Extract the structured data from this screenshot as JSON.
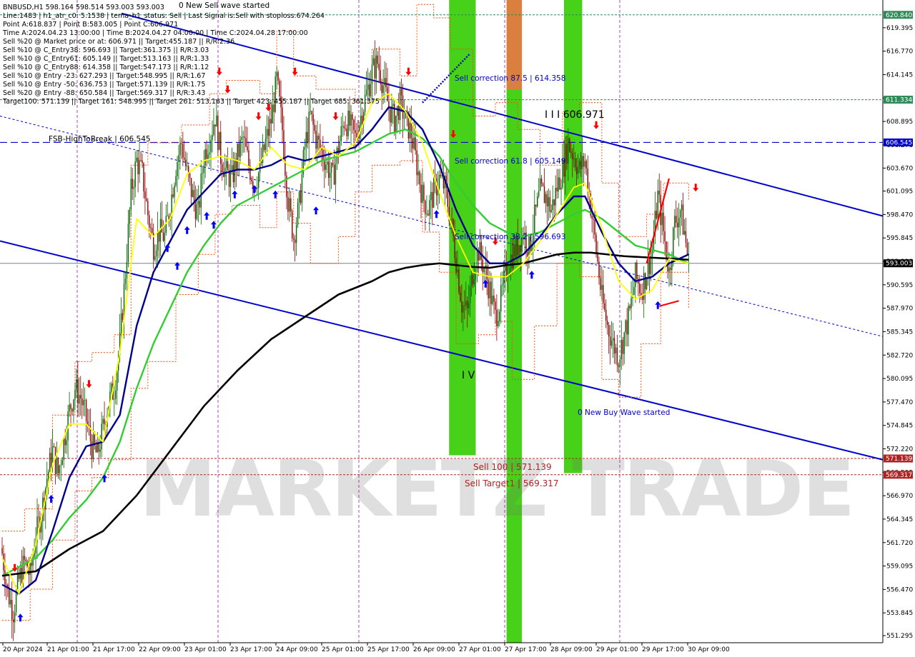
{
  "header": {
    "lines": [
      "BNBUSD,H1  598.164 598.514 593.003 593.003",
      "Line:1483 | h1_atr_c0: 5.1538 | tema_h1_status: Sell | Last Signal is:Sell with stoploss:674.264",
      "Point A:618.837 | Point B:583.005 | Point C:606.971",
      "Time A:2024.04.23 13:00:00 | Time B:2024.04.27 04:00:00 | Time C:2024.04.28 17:00:00",
      "Sell %20 @ Market price or at: 606.971 || Target:455.187 || R/R:2.36",
      "Sell %10 @ C_Entry38: 596.693 || Target:361.375 || R/R:3.03",
      "Sell %10 @ C_Entry61: 605.149 || Target:513.163 || R/R:1.33",
      "Sell %10 @ C_Entry88: 614.358 || Target:547.173 || R/R:1.12",
      "Sell %10 @ Entry -23: 627.293 || Target:548.995 || R/R:1.67",
      "Sell %10 @ Entry -50: 636.753 || Target:571.139 || R/R:1.75",
      "Sell %20 @ Entry -88: 650.584 || Target:569.317 || R/R:3.43",
      "Target100: 571.139 || Target 161: 548.995 || Target 261: 513.163 || Target 423: 455.187 || Target 685: 361.375"
    ]
  },
  "annotations": {
    "new_sell_wave": "0 New Sell wave started",
    "new_buy_wave": "0 New Buy Wave started",
    "fsb_high": "FSB-HighToBreak | 606.545",
    "sell_corr_875": "Sell correction 87.5 | 614.358",
    "sell_corr_618": "Sell correction 61.8 | 605.149",
    "sell_corr_382": "Sell correction 38.2 | 596.693",
    "wave_label": "I I I 606.971",
    "wave_iv": "I V",
    "sell_100": "Sell 100 | 571.139",
    "sell_target1": "Sell Target1 | 569.317",
    "watermark": "MARKETZ TRADE"
  },
  "price_tags": {
    "p620": "620.840",
    "p611": "611.334",
    "p606": "606.545",
    "p593": "593.003",
    "p571": "571.139",
    "p569": "569.317"
  },
  "colors": {
    "up_candle": "#006400",
    "down_candle": "#8b0000",
    "ema_fast": "#ffff00",
    "ema_mid": "#00008b",
    "ema_slow": "#32cd32",
    "ema_long": "#000000",
    "channel": "#0000cd",
    "green_zone": "#33cc00",
    "orange_zone": "#d2691e",
    "red_line": "#ff0000"
  },
  "chart_data": {
    "type": "candlestick",
    "symbol": "BNBUSD",
    "timeframe": "H1",
    "ylim": [
      550.5,
      622.5
    ],
    "y_ticks": [
      "619.395",
      "616.770",
      "614.145",
      "611.520",
      "608.895",
      "606.270",
      "603.670",
      "601.095",
      "598.470",
      "595.845",
      "593.220",
      "590.595",
      "587.970",
      "585.345",
      "582.720",
      "580.095",
      "577.470",
      "574.845",
      "572.220",
      "569.595",
      "566.970",
      "564.345",
      "561.720",
      "559.095",
      "556.470",
      "553.845",
      "551.295"
    ],
    "x_ticks": [
      "20 Apr 2024",
      "21 Apr 01:00",
      "21 Apr 17:00",
      "22 Apr 09:00",
      "23 Apr 01:00",
      "23 Apr 17:00",
      "24 Apr 09:00",
      "25 Apr 01:00",
      "25 Apr 17:00",
      "26 Apr 09:00",
      "27 Apr 01:00",
      "27 Apr 17:00",
      "28 Apr 09:00",
      "29 Apr 01:00",
      "29 Apr 17:00",
      "30 Apr 09:00"
    ],
    "levels": {
      "fsb_high": 606.545,
      "last": 593.003,
      "sell_100": 571.139,
      "sell_target1": 569.317,
      "top_green": 620.84,
      "mid_green": 611.334
    },
    "anchors_close": [
      [
        0,
        560.5
      ],
      [
        4,
        556.2
      ],
      [
        8,
        554.0
      ],
      [
        12,
        557.5
      ],
      [
        16,
        559.5
      ],
      [
        20,
        558.0
      ],
      [
        24,
        562.5
      ],
      [
        28,
        565.0
      ],
      [
        32,
        569.0
      ],
      [
        36,
        572.0
      ],
      [
        40,
        569.5
      ],
      [
        44,
        573.0
      ],
      [
        48,
        576.5
      ],
      [
        52,
        579.0
      ],
      [
        56,
        578.0
      ],
      [
        60,
        575.5
      ],
      [
        64,
        572.5
      ],
      [
        68,
        571.5
      ],
      [
        72,
        574.5
      ],
      [
        76,
        577.5
      ],
      [
        80,
        579.0
      ],
      [
        84,
        584.0
      ],
      [
        88,
        592.0
      ],
      [
        92,
        601.0
      ],
      [
        96,
        604.5
      ],
      [
        100,
        603.0
      ],
      [
        104,
        598.5
      ],
      [
        108,
        595.0
      ],
      [
        112,
        596.5
      ],
      [
        116,
        596.0
      ],
      [
        120,
        599.5
      ],
      [
        124,
        604.0
      ],
      [
        128,
        606.5
      ],
      [
        132,
        603.0
      ],
      [
        136,
        600.5
      ],
      [
        140,
        598.5
      ],
      [
        144,
        605.0
      ],
      [
        148,
        607.0
      ],
      [
        152,
        609.5
      ],
      [
        156,
        605.0
      ],
      [
        160,
        603.0
      ],
      [
        164,
        602.5
      ],
      [
        168,
        605.0
      ],
      [
        172,
        607.0
      ],
      [
        176,
        604.0
      ],
      [
        180,
        602.0
      ],
      [
        184,
        603.5
      ],
      [
        188,
        606.5
      ],
      [
        192,
        609.0
      ],
      [
        196,
        613.5
      ],
      [
        200,
        608.0
      ],
      [
        204,
        600.0
      ],
      [
        208,
        596.0
      ],
      [
        212,
        599.5
      ],
      [
        216,
        606.0
      ],
      [
        220,
        609.5
      ],
      [
        224,
        607.0
      ],
      [
        228,
        605.5
      ],
      [
        232,
        604.0
      ],
      [
        236,
        602.5
      ],
      [
        240,
        606.0
      ],
      [
        244,
        609.0
      ],
      [
        248,
        608.5
      ],
      [
        252,
        607.0
      ],
      [
        256,
        609.5
      ],
      [
        260,
        612.0
      ],
      [
        264,
        614.5
      ],
      [
        268,
        615.5
      ],
      [
        272,
        613.0
      ],
      [
        276,
        610.5
      ],
      [
        280,
        609.0
      ],
      [
        284,
        611.0
      ],
      [
        288,
        609.0
      ],
      [
        292,
        607.5
      ],
      [
        296,
        604.0
      ],
      [
        300,
        600.5
      ],
      [
        304,
        599.0
      ],
      [
        308,
        601.0
      ],
      [
        312,
        602.5
      ],
      [
        316,
        601.5
      ],
      [
        320,
        598.0
      ],
      [
        324,
        593.5
      ],
      [
        328,
        588.5
      ],
      [
        332,
        587.5
      ],
      [
        336,
        592.0
      ],
      [
        340,
        594.5
      ],
      [
        344,
        592.5
      ],
      [
        348,
        590.0
      ],
      [
        352,
        587.0
      ],
      [
        356,
        589.0
      ],
      [
        360,
        592.5
      ],
      [
        364,
        594.0
      ],
      [
        368,
        595.0
      ],
      [
        372,
        596.5
      ],
      [
        376,
        594.5
      ],
      [
        380,
        598.0
      ],
      [
        384,
        601.0
      ],
      [
        388,
        600.5
      ],
      [
        392,
        599.0
      ],
      [
        396,
        601.5
      ],
      [
        400,
        603.5
      ],
      [
        404,
        606.5
      ],
      [
        408,
        605.0
      ],
      [
        412,
        603.5
      ],
      [
        416,
        604.5
      ],
      [
        420,
        599.5
      ],
      [
        424,
        594.5
      ],
      [
        428,
        589.0
      ],
      [
        432,
        586.0
      ],
      [
        436,
        584.0
      ],
      [
        440,
        582.5
      ],
      [
        444,
        585.0
      ],
      [
        448,
        587.5
      ],
      [
        452,
        591.5
      ],
      [
        456,
        590.0
      ],
      [
        460,
        592.0
      ],
      [
        464,
        594.5
      ],
      [
        468,
        600.5
      ],
      [
        472,
        596.5
      ],
      [
        476,
        592.0
      ],
      [
        480,
        597.5
      ],
      [
        484,
        599.0
      ],
      [
        487,
        596.5
      ],
      [
        490,
        593.0
      ]
    ],
    "ema_fast": [
      [
        0,
        560
      ],
      [
        12,
        556
      ],
      [
        24,
        561.5
      ],
      [
        36,
        570.5
      ],
      [
        48,
        575
      ],
      [
        60,
        575
      ],
      [
        72,
        573
      ],
      [
        84,
        583
      ],
      [
        96,
        598
      ],
      [
        108,
        596
      ],
      [
        120,
        598
      ],
      [
        132,
        603
      ],
      [
        144,
        604.5
      ],
      [
        156,
        605
      ],
      [
        168,
        604.5
      ],
      [
        180,
        603.5
      ],
      [
        192,
        606
      ],
      [
        204,
        604
      ],
      [
        216,
        603.5
      ],
      [
        228,
        606
      ],
      [
        240,
        605
      ],
      [
        252,
        606.5
      ],
      [
        264,
        611
      ],
      [
        276,
        612
      ],
      [
        288,
        610
      ],
      [
        300,
        606.5
      ],
      [
        312,
        601
      ],
      [
        324,
        596
      ],
      [
        336,
        592
      ],
      [
        348,
        591.5
      ],
      [
        360,
        591.5
      ],
      [
        372,
        593
      ],
      [
        384,
        595.5
      ],
      [
        396,
        598.5
      ],
      [
        408,
        601.5
      ],
      [
        416,
        602
      ],
      [
        428,
        597
      ],
      [
        440,
        591
      ],
      [
        452,
        589
      ],
      [
        464,
        590
      ],
      [
        476,
        593.5
      ],
      [
        490,
        593
      ]
    ],
    "ema_mid": [
      [
        0,
        557
      ],
      [
        12,
        556
      ],
      [
        24,
        557.5
      ],
      [
        36,
        563
      ],
      [
        48,
        569
      ],
      [
        60,
        572.5
      ],
      [
        72,
        573
      ],
      [
        84,
        576
      ],
      [
        96,
        586
      ],
      [
        108,
        592
      ],
      [
        120,
        595.5
      ],
      [
        132,
        599
      ],
      [
        144,
        601
      ],
      [
        156,
        603
      ],
      [
        168,
        603.5
      ],
      [
        180,
        603.5
      ],
      [
        192,
        604
      ],
      [
        204,
        605
      ],
      [
        216,
        604.5
      ],
      [
        228,
        605
      ],
      [
        240,
        605.5
      ],
      [
        252,
        606
      ],
      [
        264,
        608
      ],
      [
        276,
        610.5
      ],
      [
        288,
        610
      ],
      [
        300,
        608
      ],
      [
        312,
        604
      ],
      [
        324,
        599
      ],
      [
        336,
        595
      ],
      [
        348,
        593
      ],
      [
        360,
        593
      ],
      [
        372,
        594
      ],
      [
        384,
        596
      ],
      [
        396,
        598.5
      ],
      [
        408,
        600.5
      ],
      [
        416,
        600.5
      ],
      [
        428,
        596.5
      ],
      [
        440,
        593
      ],
      [
        452,
        591
      ],
      [
        464,
        591.5
      ],
      [
        476,
        593
      ],
      [
        490,
        594
      ]
    ],
    "ema_slow": [
      [
        0,
        558
      ],
      [
        12,
        559
      ],
      [
        24,
        560
      ],
      [
        36,
        562
      ],
      [
        48,
        564.5
      ],
      [
        60,
        566.5
      ],
      [
        72,
        569
      ],
      [
        84,
        573
      ],
      [
        96,
        579
      ],
      [
        108,
        584
      ],
      [
        120,
        588
      ],
      [
        132,
        592
      ],
      [
        144,
        595
      ],
      [
        156,
        597.5
      ],
      [
        168,
        599.5
      ],
      [
        180,
        600.5
      ],
      [
        192,
        601.5
      ],
      [
        204,
        602.5
      ],
      [
        216,
        603.5
      ],
      [
        228,
        604.5
      ],
      [
        240,
        605
      ],
      [
        252,
        605.5
      ],
      [
        264,
        606.5
      ],
      [
        276,
        607.5
      ],
      [
        288,
        608
      ],
      [
        300,
        607
      ],
      [
        312,
        605
      ],
      [
        324,
        602
      ],
      [
        336,
        599.5
      ],
      [
        348,
        597.5
      ],
      [
        360,
        596.5
      ],
      [
        372,
        596
      ],
      [
        384,
        596.5
      ],
      [
        396,
        597.5
      ],
      [
        408,
        598.5
      ],
      [
        416,
        599
      ],
      [
        428,
        598
      ],
      [
        440,
        596.5
      ],
      [
        452,
        595
      ],
      [
        464,
        594.5
      ],
      [
        476,
        594
      ],
      [
        490,
        593
      ]
    ],
    "ema_long": [
      [
        0,
        558
      ],
      [
        24,
        558.5
      ],
      [
        48,
        561
      ],
      [
        72,
        563
      ],
      [
        96,
        567
      ],
      [
        120,
        572
      ],
      [
        144,
        577
      ],
      [
        168,
        581
      ],
      [
        192,
        584.5
      ],
      [
        216,
        587
      ],
      [
        240,
        589.5
      ],
      [
        264,
        591
      ],
      [
        276,
        592
      ],
      [
        288,
        592.5
      ],
      [
        300,
        592.8
      ],
      [
        312,
        593
      ],
      [
        324,
        592.8
      ],
      [
        336,
        592.6
      ],
      [
        348,
        592.5
      ],
      [
        360,
        592.8
      ],
      [
        372,
        593
      ],
      [
        384,
        593.5
      ],
      [
        396,
        594
      ],
      [
        408,
        594.2
      ],
      [
        420,
        594.2
      ],
      [
        432,
        594
      ],
      [
        444,
        593.8
      ],
      [
        456,
        593.7
      ],
      [
        468,
        593.6
      ],
      [
        480,
        593.5
      ],
      [
        490,
        593.4
      ]
    ],
    "zones": [
      {
        "color": "green",
        "from": 319,
        "to": 338,
        "top": 622.5,
        "bottom": 571.5
      },
      {
        "color": "orange",
        "from": 360,
        "to": 371,
        "top": 622.5,
        "bottom": 612.5
      },
      {
        "color": "green",
        "from": 360,
        "to": 371,
        "top": 612.5,
        "bottom": 550.5
      },
      {
        "color": "green",
        "from": 401,
        "to": 414,
        "top": 622.5,
        "bottom": 569.5
      }
    ]
  }
}
